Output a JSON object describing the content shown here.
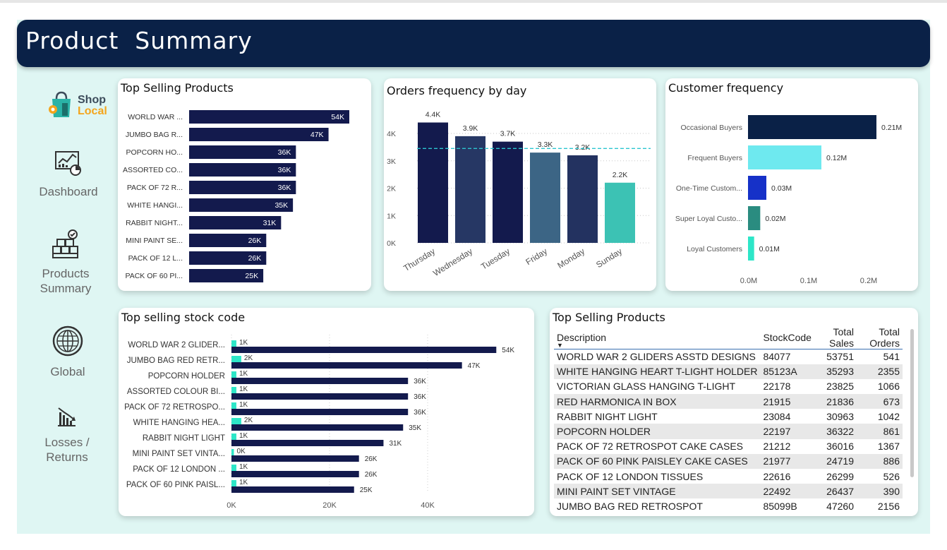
{
  "page": {
    "title": "Product  Summary"
  },
  "colors": {
    "navy": "#0a2147",
    "teal": "#2ee6c4",
    "canvas": "#dff6f3"
  },
  "logo": {
    "line1": "Shop",
    "line2": "Local"
  },
  "nav": [
    {
      "label": "Dashboard",
      "icon": "dashboard-icon"
    },
    {
      "label": "Products Summary",
      "icon": "boxes-icon"
    },
    {
      "label": "Global",
      "icon": "globe-icon"
    },
    {
      "label": "Losses / Returns",
      "icon": "chart-down-icon"
    }
  ],
  "chart_data": [
    {
      "id": "top_selling_products",
      "type": "bar",
      "orientation": "horizontal",
      "title": "Top Selling Products",
      "categories": [
        "WORLD WAR ...",
        "JUMBO BAG R...",
        "POPCORN HO...",
        "ASSORTED CO...",
        "PACK OF 72 R...",
        "WHITE HANGI...",
        "RABBIT NIGHT...",
        "MINI PAINT SE...",
        "PACK OF 12 L...",
        "PACK OF 60 PI..."
      ],
      "values": [
        54000,
        47000,
        36000,
        36000,
        36000,
        35000,
        31000,
        26000,
        26000,
        25000
      ],
      "data_labels": [
        "54K",
        "47K",
        "36K",
        "36K",
        "36K",
        "35K",
        "31K",
        "26K",
        "26K",
        "25K"
      ],
      "color": "#131a4d",
      "xlim": [
        0,
        54000
      ]
    },
    {
      "id": "orders_by_day",
      "type": "bar",
      "title": "Orders frequency by day",
      "categories": [
        "Thursday",
        "Wednesday",
        "Tuesday",
        "Friday",
        "Monday",
        "Sunday"
      ],
      "values": [
        4400,
        3900,
        3700,
        3300,
        3200,
        2200
      ],
      "data_labels": [
        "4.4K",
        "3.9K",
        "3.7K",
        "3.3K",
        "3.2K",
        "2.2K"
      ],
      "colors": [
        "#131a4d",
        "#263764",
        "#131a4d",
        "#3c6585",
        "#233260",
        "#3cc2b4"
      ],
      "yticks": [
        "0K",
        "1K",
        "2K",
        "3K",
        "4K"
      ],
      "ylim": [
        0,
        4400
      ],
      "average_line": 3450,
      "grid": true
    },
    {
      "id": "customer_frequency",
      "type": "bar",
      "orientation": "horizontal",
      "title": "Customer frequency",
      "categories": [
        "Occasional Buyers",
        "Frequent Buyers",
        "One-Time Custom...",
        "Super Loyal Custo...",
        "Loyal Customers"
      ],
      "values": [
        0.21,
        0.12,
        0.03,
        0.02,
        0.01
      ],
      "data_labels": [
        "0.21M",
        "0.12M",
        "0.03M",
        "0.02M",
        "0.01M"
      ],
      "colors": [
        "#0a2147",
        "#6ee9ef",
        "#1631c8",
        "#2a8c80",
        "#2de6c8"
      ],
      "xticks": [
        "0.0M",
        "0.1M",
        "0.2M"
      ],
      "xlim": [
        0,
        0.21
      ]
    },
    {
      "id": "top_selling_stock_code",
      "type": "bar",
      "orientation": "horizontal",
      "title": "Top selling stock code",
      "categories": [
        "WORLD WAR 2 GLIDER...",
        "JUMBO BAG RED RETR...",
        "POPCORN HOLDER",
        "ASSORTED COLOUR BI...",
        "PACK OF 72 RETROSPO...",
        "WHITE HANGING HEA...",
        "RABBIT NIGHT LIGHT",
        "MINI PAINT SET VINTA...",
        "PACK OF 12 LONDON ...",
        "PACK OF 60 PINK PAISL..."
      ],
      "series": [
        {
          "values": [
            1000,
            2000,
            1000,
            1000,
            1000,
            2000,
            1000,
            500,
            1000,
            1000
          ],
          "data_labels": [
            "1K",
            "2K",
            "1K",
            "1K",
            "1K",
            "2K",
            "1K",
            "0K",
            "1K",
            "1K"
          ],
          "color": "#2de6c8"
        },
        {
          "values": [
            54000,
            47000,
            36000,
            36000,
            36000,
            35000,
            31000,
            26000,
            26000,
            25000
          ],
          "data_labels": [
            "54K",
            "47K",
            "36K",
            "36K",
            "36K",
            "35K",
            "31K",
            "26K",
            "26K",
            "25K"
          ],
          "color": "#131a4d"
        }
      ],
      "xticks": [
        "0K",
        "20K",
        "40K"
      ],
      "xtick_values": [
        0,
        20000,
        40000
      ],
      "xlim": [
        0,
        54000
      ],
      "grid": true
    }
  ],
  "table": {
    "title": "Top Selling Products",
    "columns": [
      "Description",
      "StockCode",
      "Total Sales",
      "Total Orders"
    ],
    "rows": [
      [
        "WORLD WAR 2 GLIDERS ASSTD DESIGNS",
        "84077",
        "53751",
        "541"
      ],
      [
        "WHITE HANGING HEART T-LIGHT HOLDER",
        "85123A",
        "35293",
        "2355"
      ],
      [
        "VICTORIAN GLASS HANGING T-LIGHT",
        "22178",
        "23825",
        "1066"
      ],
      [
        "RED HARMONICA IN BOX",
        "21915",
        "21836",
        "673"
      ],
      [
        "RABBIT NIGHT LIGHT",
        "23084",
        "30963",
        "1042"
      ],
      [
        "POPCORN HOLDER",
        "22197",
        "36322",
        "861"
      ],
      [
        "PACK OF 72 RETROSPOT CAKE CASES",
        "21212",
        "36016",
        "1367"
      ],
      [
        "PACK OF 60 PINK PAISLEY CAKE CASES",
        "21977",
        "24719",
        "886"
      ],
      [
        "PACK OF 12 LONDON TISSUES",
        "22616",
        "26299",
        "526"
      ],
      [
        "MINI PAINT SET VINTAGE",
        "22492",
        "26437",
        "390"
      ],
      [
        "JUMBO BAG RED RETROSPOT",
        "85099B",
        "47260",
        "2156"
      ]
    ]
  }
}
